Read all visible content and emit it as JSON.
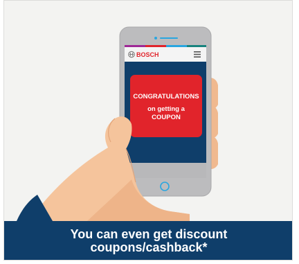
{
  "colors": {
    "background": "#f3f3f1",
    "caption_bg": "#0f3e6a",
    "phone_body": "#bcbcbe",
    "screen_bg": "#0f3e6a",
    "popup_red": "#e1242b",
    "skin": "#f5c49c",
    "brand_red": "#e1242b",
    "accent_line": "#29a6e0"
  },
  "phone": {
    "brand_name": "BOSCH",
    "brand_icon": "bosch-logo-icon",
    "menu_icon": "hamburger-menu-icon",
    "popup": {
      "line1": "CONGRATULATIONS",
      "line2": "on getting a",
      "line3": "COUPON"
    }
  },
  "caption": {
    "line1": "You can even get discount",
    "line2": "coupons/cashback*"
  }
}
